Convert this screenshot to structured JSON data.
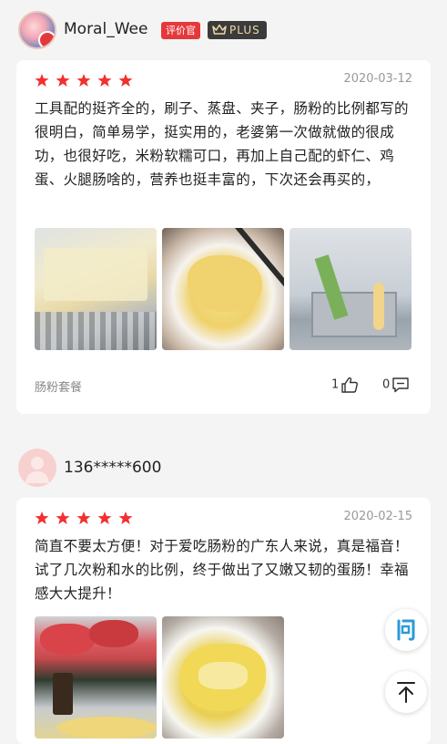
{
  "reviews": [
    {
      "user": "Moral_Wee",
      "tag_evaluator": "评价官",
      "tag_plus": "PLUS",
      "rating": 5,
      "date": "2020-03-12",
      "text": "工具配的挺齐全的，刷子、蒸盘、夹子，肠粉的比例都写的很明白，简单易学，挺实用的，老婆第一次做就做的很成功，也很好吃，米粉软糯可口，再加上自己配的虾仁、鸡蛋、火腿肠啥的，营养也挺丰富的，下次还会再买的，",
      "product_tag": "肠粉套餐",
      "likes": "1",
      "comments": "0"
    },
    {
      "user": "136*****600",
      "rating": 5,
      "date": "2020-02-15",
      "text": "简直不要太方便！对于爱吃肠粉的广东人来说，真是福音！试了几次粉和水的比例，终于做出了又嫩又韧的蛋肠！幸福感大大提升！"
    }
  ],
  "colors": {
    "accent": "#e4393c",
    "star": "#f23030",
    "plus_bg": "#3b3b3b",
    "plus_text": "#f0d9a8"
  },
  "icons": [
    "thumbs-up-icon",
    "comment-icon",
    "ask-icon",
    "back-to-top-icon",
    "crown-icon",
    "star-icon"
  ]
}
